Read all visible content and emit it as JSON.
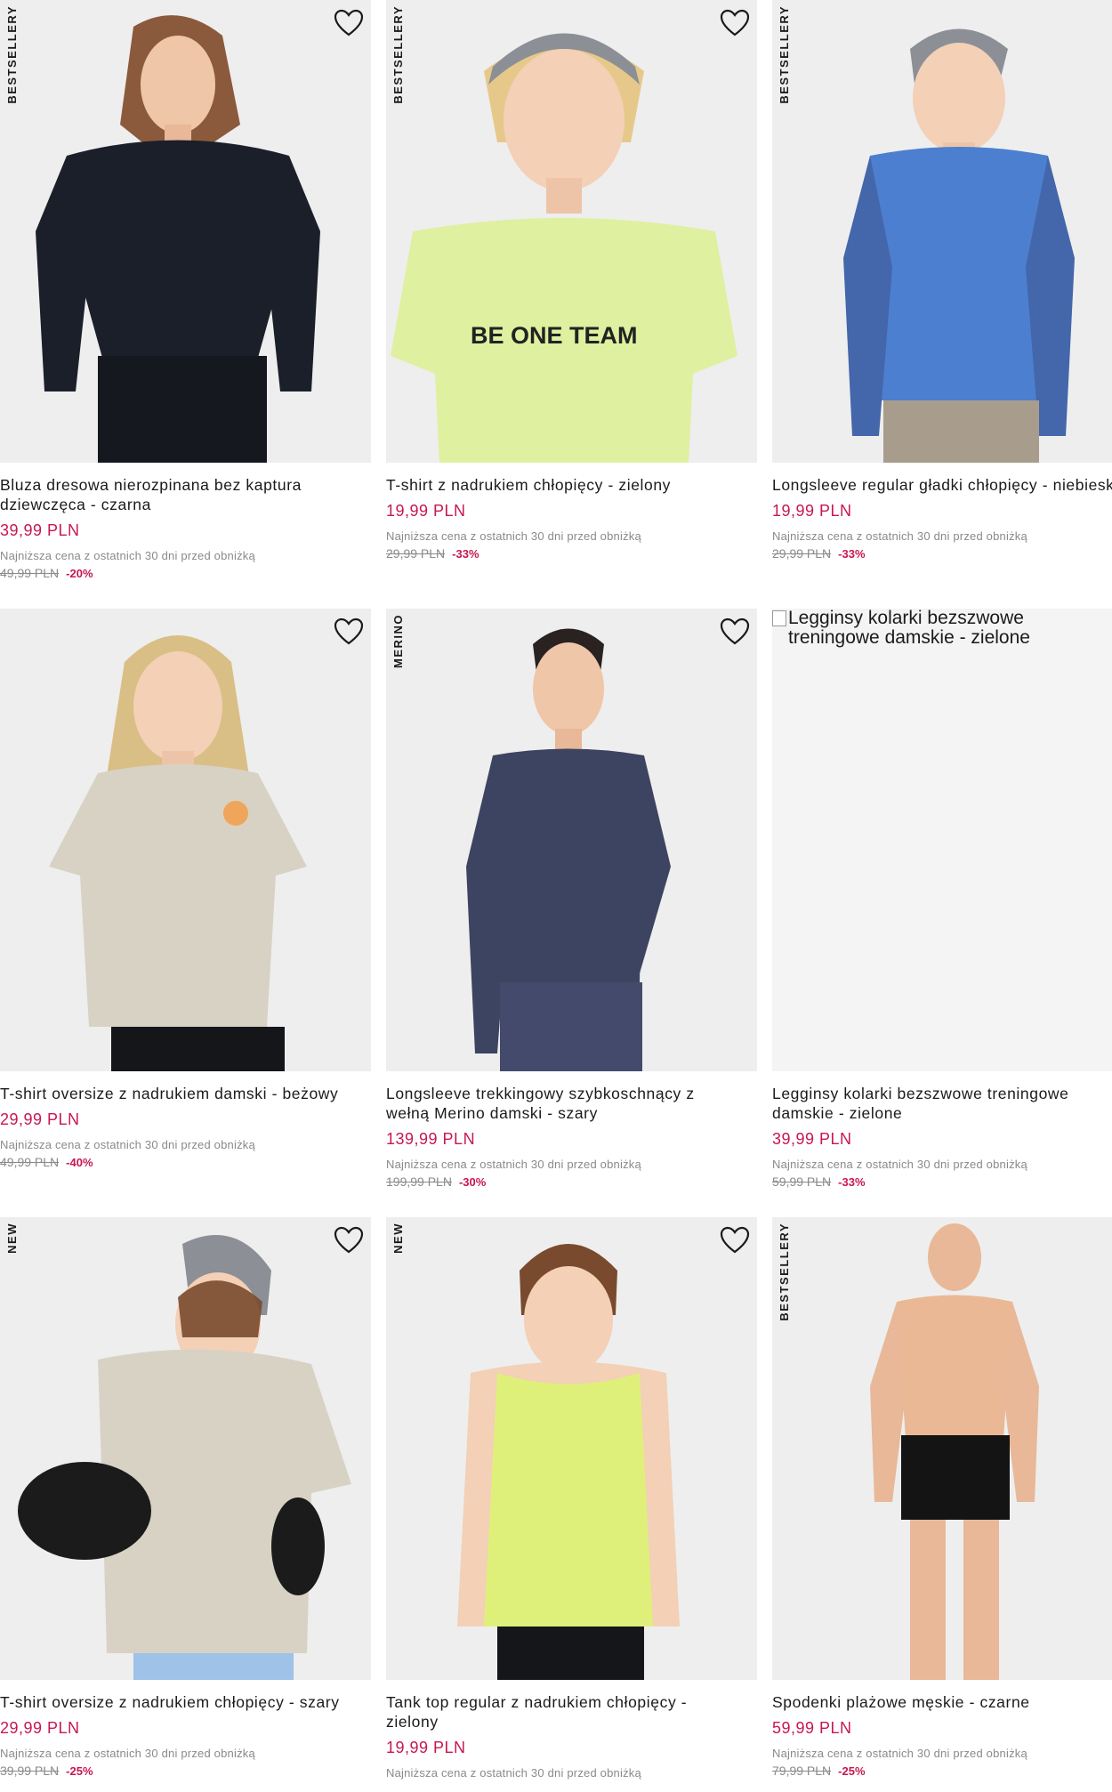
{
  "products": [
    {
      "badge": "BESTSELLERY",
      "title": "Bluza dresowa nierozpinana bez kaptura dziewczęca - czarna",
      "price": "39,99 PLN",
      "lowest_label": "Najniższa cena z ostatnich 30 dni przed obniżką",
      "old_price": "49,99 PLN",
      "discount": "-20%"
    },
    {
      "badge": "BESTSELLERY",
      "title": "T-shirt z nadrukiem chłopięcy - zielony",
      "price": "19,99 PLN",
      "lowest_label": "Najniższa cena z ostatnich 30 dni przed obniżką",
      "old_price": "29,99 PLN",
      "discount": "-33%",
      "print": "BE ONE TEAM"
    },
    {
      "badge": "BESTSELLERY",
      "title": "Longsleeve regular gładki chłopięcy - niebieski",
      "price": "19,99 PLN",
      "lowest_label": "Najniższa cena z ostatnich 30 dni przed obniżką",
      "old_price": "29,99 PLN",
      "discount": "-33%"
    },
    {
      "badge": "",
      "title": "T-shirt oversize z nadrukiem damski - beżowy",
      "price": "29,99 PLN",
      "lowest_label": "Najniższa cena z ostatnich 30 dni przed obniżką",
      "old_price": "49,99 PLN",
      "discount": "-40%"
    },
    {
      "badge": "MERINO",
      "title": "Longsleeve trekkingowy szybkoschnący z wełną Merino damski - szary",
      "price": "139,99 PLN",
      "lowest_label": "Najniższa cena z ostatnich 30 dni przed obniżką",
      "old_price": "199,99 PLN",
      "discount": "-30%"
    },
    {
      "badge": "",
      "title": "Legginsy kolarki bezszwowe treningowe damskie - zielone",
      "price": "39,99 PLN",
      "lowest_label": "Najniższa cena z ostatnich 30 dni przed obniżką",
      "old_price": "59,99 PLN",
      "discount": "-33%",
      "image_alt": "Legginsy kolarki bezszwowe treningowe damskie - zielone"
    },
    {
      "badge": "NEW",
      "title": "T-shirt oversize z nadrukiem chłopięcy - szary",
      "price": "29,99 PLN",
      "lowest_label": "Najniższa cena z ostatnich 30 dni przed obniżką",
      "old_price": "39,99 PLN",
      "discount": "-25%"
    },
    {
      "badge": "NEW",
      "title": "Tank top regular z nadrukiem chłopięcy - zielony",
      "price": "19,99 PLN",
      "lowest_label": "Najniższa cena z ostatnich 30 dni przed obniżką",
      "old_price": "",
      "discount": ""
    },
    {
      "badge": "BESTSELLERY",
      "title": "Spodenki plażowe męskie - czarne",
      "price": "59,99 PLN",
      "lowest_label": "Najniższa cena z ostatnich 30 dni przed obniżką",
      "old_price": "79,99 PLN",
      "discount": "-25%"
    }
  ],
  "colors": {
    "price": "#c8174e",
    "muted": "#8a8a8a",
    "photo_bg": "#eeeeee"
  },
  "icons": {
    "wishlist": "heart-outline-icon"
  }
}
